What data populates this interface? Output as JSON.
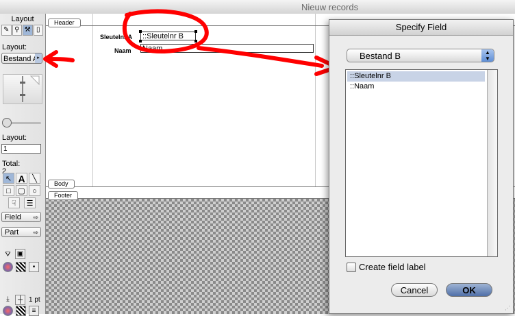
{
  "window": {
    "title": "Nieuw records"
  },
  "left_panel": {
    "heading": "Layout",
    "layout_label": "Layout:",
    "layout_popup": "Bestand A",
    "layout_number_label": "Layout:",
    "layout_number_value": "1",
    "total_label": "Total:",
    "total_value": "2",
    "field_button": "Field",
    "part_button": "Part",
    "line_width": "1 pt",
    "text_tool": "A"
  },
  "canvas": {
    "header_tab": "Header",
    "body_tab": "Body",
    "footer_tab": "Footer",
    "fields": [
      {
        "label": "Sleutelnr A",
        "value": "::Sleutelnr B"
      },
      {
        "label": "Naam",
        "value": "Naam"
      }
    ]
  },
  "dialog": {
    "title": "Specify Field",
    "table_popup": "Bestand B",
    "fields": [
      "::Sleutelnr B",
      "::Naam"
    ],
    "selected_index": 0,
    "create_label_text": "Create field label",
    "create_label_checked": false,
    "cancel_label": "Cancel",
    "ok_label": "OK"
  },
  "annotations": {
    "color": "#ff0000"
  }
}
